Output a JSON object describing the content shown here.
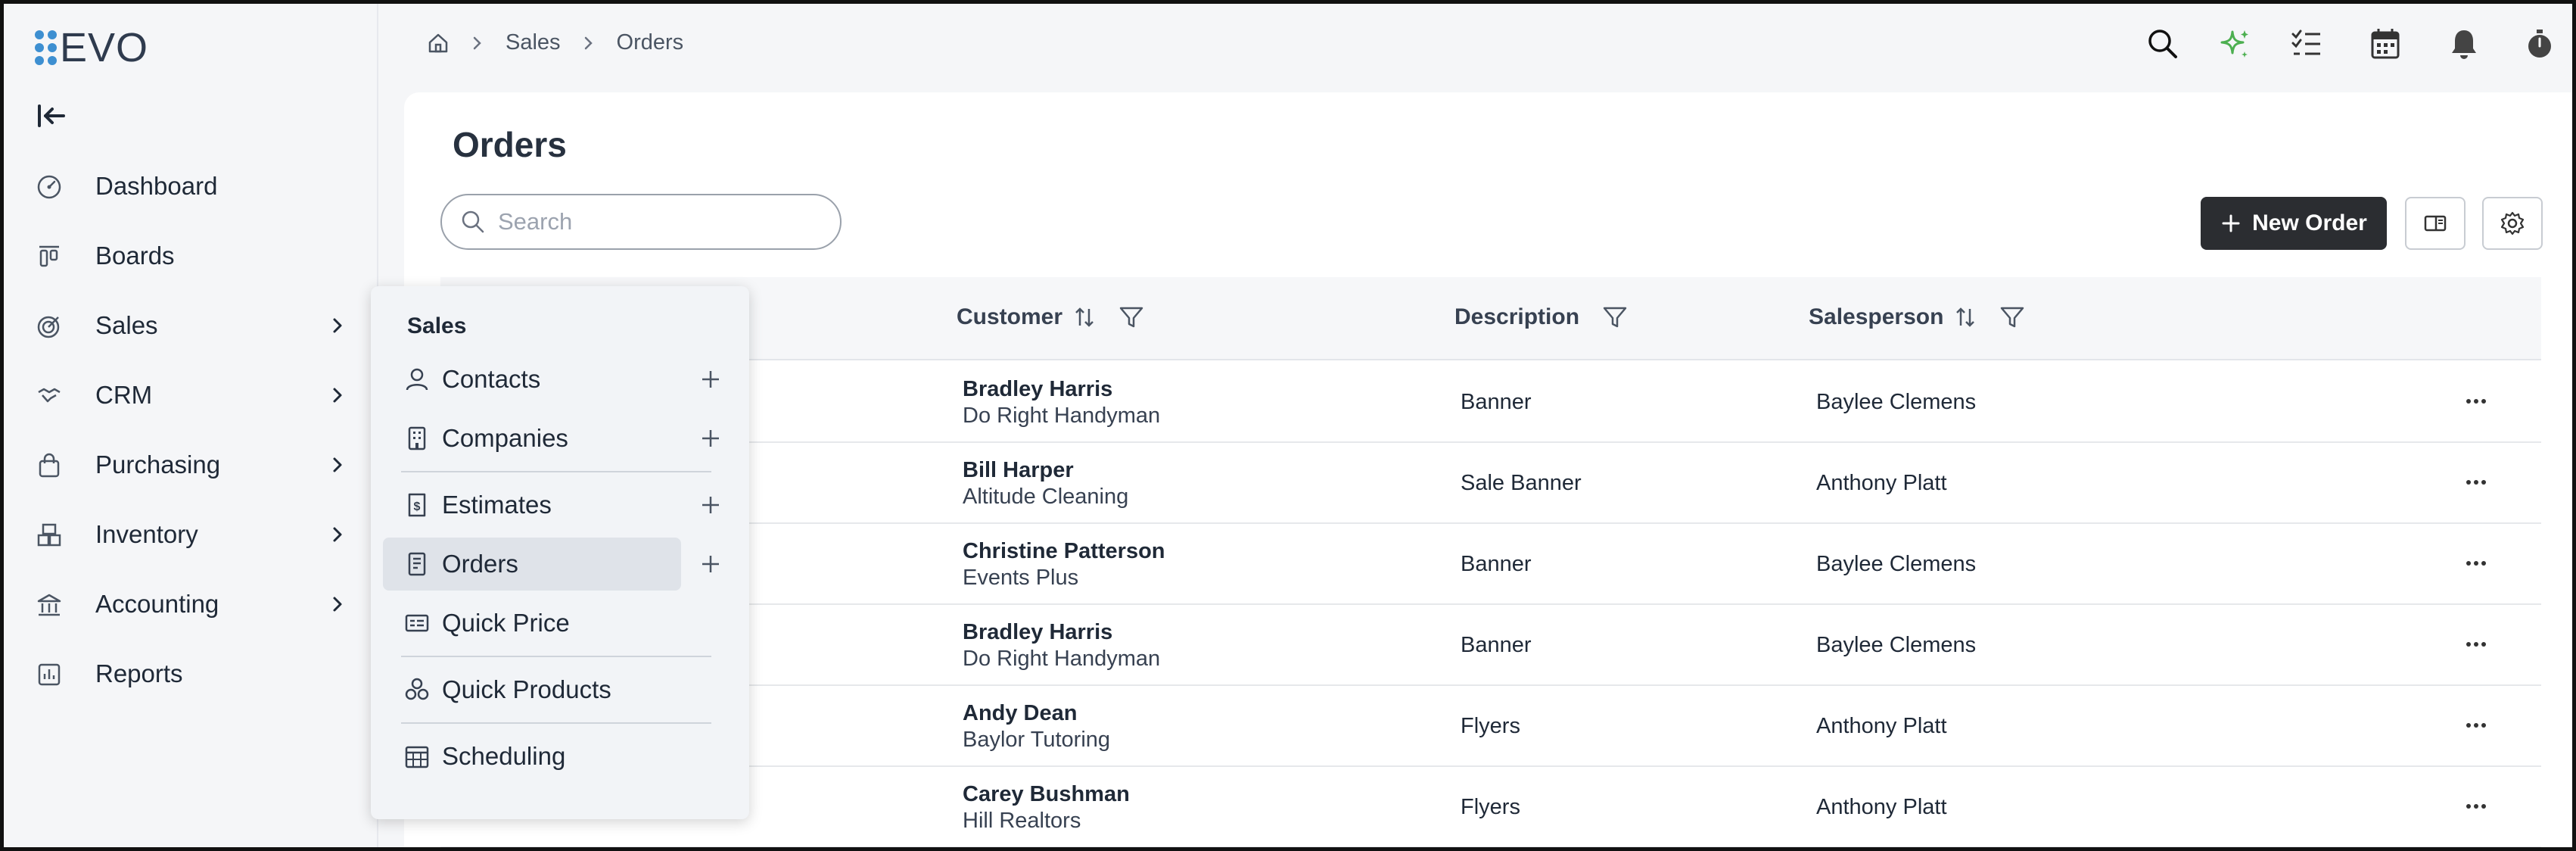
{
  "app": {
    "logo_text": "EVO"
  },
  "sidebar": {
    "items": [
      {
        "label": "Dashboard",
        "icon": "dashboard-icon",
        "has_chevron": false
      },
      {
        "label": "Boards",
        "icon": "boards-icon",
        "has_chevron": false
      },
      {
        "label": "Sales",
        "icon": "target-icon",
        "has_chevron": true
      },
      {
        "label": "CRM",
        "icon": "handshake-icon",
        "has_chevron": true
      },
      {
        "label": "Purchasing",
        "icon": "shopping-bag-icon",
        "has_chevron": true
      },
      {
        "label": "Inventory",
        "icon": "boxes-icon",
        "has_chevron": true
      },
      {
        "label": "Accounting",
        "icon": "bank-icon",
        "has_chevron": true
      },
      {
        "label": "Reports",
        "icon": "chart-icon",
        "has_chevron": false
      }
    ]
  },
  "breadcrumb": {
    "items": [
      "Sales",
      "Orders"
    ]
  },
  "page": {
    "title": "Orders"
  },
  "search": {
    "placeholder": "Search"
  },
  "toolbar": {
    "new_order_label": "New Order"
  },
  "table": {
    "columns": [
      "Customer",
      "Description",
      "Salesperson"
    ],
    "rows": [
      {
        "customer": "Bradley Harris",
        "company": "Do Right Handyman",
        "description": "Banner",
        "salesperson": "Baylee Clemens"
      },
      {
        "customer": "Bill Harper",
        "company": "Altitude Cleaning",
        "description": "Sale Banner",
        "salesperson": "Anthony Platt"
      },
      {
        "customer": "Christine Patterson",
        "company": "Events Plus",
        "description": "Banner",
        "salesperson": "Baylee Clemens"
      },
      {
        "customer": "Bradley Harris",
        "company": "Do Right Handyman",
        "description": "Banner",
        "salesperson": "Baylee Clemens"
      },
      {
        "customer": "Andy Dean",
        "company": "Baylor Tutoring",
        "description": "Flyers",
        "salesperson": "Anthony Platt"
      },
      {
        "customer": "Carey Bushman",
        "company": "Hill Realtors",
        "description": "Flyers",
        "salesperson": "Anthony Platt"
      }
    ]
  },
  "flyout": {
    "title": "Sales",
    "items": [
      {
        "label": "Contacts",
        "icon": "person-icon",
        "has_add": true
      },
      {
        "label": "Companies",
        "icon": "building-icon",
        "has_add": true
      },
      {
        "label": "Estimates",
        "icon": "estimate-icon",
        "has_add": true
      },
      {
        "label": "Orders",
        "icon": "order-icon",
        "has_add": true,
        "active": true
      },
      {
        "label": "Quick Price",
        "icon": "price-card-icon",
        "has_add": false
      },
      {
        "label": "Quick Products",
        "icon": "products-icon",
        "has_add": false
      },
      {
        "label": "Scheduling",
        "icon": "calendar-grid-icon",
        "has_add": false
      }
    ]
  },
  "colors": {
    "accent_dark": "#2b2d31",
    "sparkle": "#4caf50",
    "logo_blue": "#3d8fd1"
  }
}
